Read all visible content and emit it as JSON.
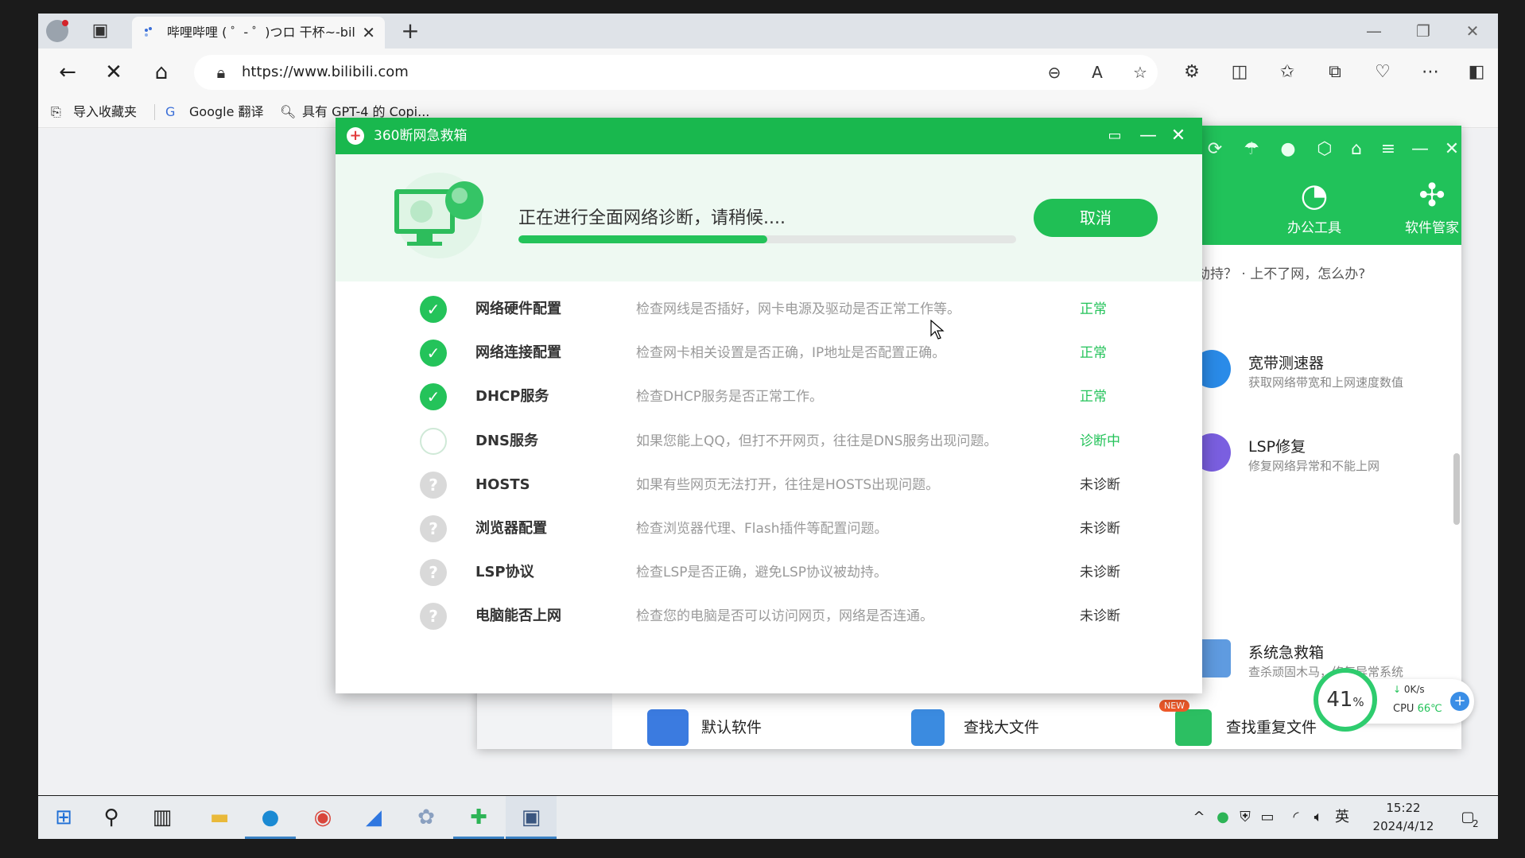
{
  "browser": {
    "tab_title": "哔哩哔哩 ( ゜- ゜)つロ 干杯~-bilibili",
    "url": "https://www.bilibili.com",
    "favorites": [
      "导入收藏夹",
      "Google 翻译",
      "具有 GPT-4 的 Copi..."
    ]
  },
  "app360": {
    "header_tools": [
      {
        "icon": "office-tools-icon",
        "label": "办公工具"
      },
      {
        "icon": "software-manager-icon",
        "label": "软件管家"
      }
    ],
    "tip": "劫持？ · 上不了网，怎么办?",
    "features": [
      {
        "title": "宽带测速器",
        "subtitle": "获取网络带宽和上网速度数值",
        "color": "#2a8be8"
      },
      {
        "title": "LSP修复",
        "subtitle": "修复网络异常和不能上网",
        "color": "#7a5fe0"
      },
      {
        "title": "系统急救箱",
        "subtitle": "查杀顽固木马，修复异常系统",
        "color": "#5f9be0"
      }
    ],
    "bottom_items": [
      {
        "label": "默认软件",
        "color": "#3b7be0"
      },
      {
        "label": "查找大文件",
        "color": "#3b8be0"
      },
      {
        "label": "查找重复文件",
        "color": "#2cbf62",
        "badge": "NEW"
      }
    ]
  },
  "dialog": {
    "title": "360断网急救箱",
    "status": "正在进行全面网络诊断，请稍候....",
    "progress": 0.5,
    "cancel_label": "取消",
    "rows": [
      {
        "name": "网络硬件配置",
        "desc": "检查网线是否插好，网卡电源及驱动是否正常工作等。",
        "result": "正常",
        "state": "ok"
      },
      {
        "name": "网络连接配置",
        "desc": "检查网卡相关设置是否正确，IP地址是否配置正确。",
        "result": "正常",
        "state": "ok"
      },
      {
        "name": "DHCP服务",
        "desc": "检查DHCP服务是否正常工作。",
        "result": "正常",
        "state": "ok"
      },
      {
        "name": "DNS服务",
        "desc": "如果您能上QQ，但打不开网页，往往是DNS服务出现问题。",
        "result": "诊断中",
        "state": "busy"
      },
      {
        "name": "HOSTS",
        "desc": "如果有些网页无法打开，往往是HOSTS出现问题。",
        "result": "未诊断",
        "state": "pend"
      },
      {
        "name": "浏览器配置",
        "desc": "检查浏览器代理、Flash插件等配置问题。",
        "result": "未诊断",
        "state": "pend"
      },
      {
        "name": "LSP协议",
        "desc": "检查LSP是否正确，避免LSP协议被劫持。",
        "result": "未诊断",
        "state": "pend"
      },
      {
        "name": "电脑能否上网",
        "desc": "检查您的电脑是否可以访问网页，网络是否连通。",
        "result": "未诊断",
        "state": "pend"
      }
    ],
    "colors": {
      "ok": "#24c35a",
      "busy": "#24c35a",
      "pend": "#333333"
    }
  },
  "speedball": {
    "percent": "41",
    "percent_unit": "%",
    "net": "0K/s",
    "cpu_label": "CPU",
    "cpu_temp": "66℃"
  },
  "taskbar": {
    "ime": "英",
    "time": "15:22",
    "date": "2024/4/12",
    "notification_count": "2"
  }
}
